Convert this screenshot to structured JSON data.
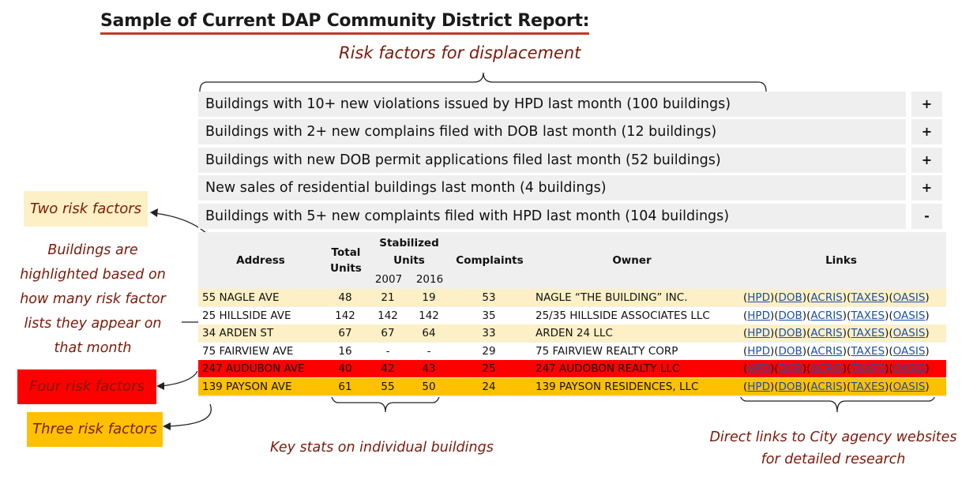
{
  "title": "Sample of Current DAP Community District Report:",
  "subtitle": "Risk factors for displacement",
  "risk_factors": [
    {
      "label": "Buildings with 10+ new violations issued by HPD last month (100 buildings)",
      "toggle": "+"
    },
    {
      "label": "Buildings with 2+ new complains filed with DOB last month (12 buildings)",
      "toggle": "+"
    },
    {
      "label": "Buildings with new DOB permit applications filed last month (52 buildings)",
      "toggle": "+"
    },
    {
      "label": "New sales of residential buildings last month (4 buildings)",
      "toggle": "+"
    },
    {
      "label": "Buildings with 5+ new complaints filed with HPD last month (104 buildings)",
      "toggle": "-"
    }
  ],
  "table": {
    "headers": {
      "address": "Address",
      "total_units_1": "Total",
      "total_units_2": "Units",
      "stabilized_1": "Stabilized",
      "stabilized_2": "Units",
      "year_2007": "2007",
      "year_2016": "2016",
      "complaints": "Complaints",
      "owner": "Owner",
      "links": "Links"
    },
    "link_labels": [
      "HPD",
      "DOB",
      "ACRIS",
      "TAXES",
      "OASIS"
    ],
    "rows": [
      {
        "address": "55 NAGLE AVE",
        "total": "48",
        "s2007": "21",
        "s2016": "19",
        "complaints": "53",
        "owner": "NAGLE “THE BUILDING” INC.",
        "color": "#fdf0c6"
      },
      {
        "address": "25 HILLSIDE AVE",
        "total": "142",
        "s2007": "142",
        "s2016": "142",
        "complaints": "35",
        "owner": "25/35 HILLSIDE ASSOCIATES LLC",
        "color": "#ffffff"
      },
      {
        "address": "34 ARDEN ST",
        "total": "67",
        "s2007": "67",
        "s2016": "64",
        "complaints": "33",
        "owner": "ARDEN 24 LLC",
        "color": "#fdf0c6"
      },
      {
        "address": "75 FAIRVIEW AVE",
        "total": "16",
        "s2007": "-",
        "s2016": "-",
        "complaints": "29",
        "owner": "75 FAIRVIEW REALTY CORP",
        "color": "#ffffff"
      },
      {
        "address": "247 AUDUBON AVE",
        "total": "40",
        "s2007": "42",
        "s2016": "43",
        "complaints": "25",
        "owner": "247 AUDOBON REALTY LLC",
        "color": "#ff0000"
      },
      {
        "address": "139 PAYSON AVE",
        "total": "61",
        "s2007": "55",
        "s2016": "50",
        "complaints": "24",
        "owner": "139 PAYSON RESIDENCES, LLC",
        "color": "#ffc000"
      }
    ]
  },
  "annotations": {
    "two_risk": "Two risk factors",
    "two_risk_color": "#fdf0c6",
    "four_risk": "Four risk factors",
    "four_risk_color": "#ff0000",
    "three_risk": "Three risk factors",
    "three_risk_color": "#ffc000",
    "highlight_note": [
      "Buildings are",
      "highlighted based on",
      "how many risk factor",
      "lists they appear on",
      "that month"
    ],
    "key_stats": "Key stats on individual buildings",
    "direct_links": [
      "Direct links to City agency websites",
      "for detailed research"
    ]
  }
}
